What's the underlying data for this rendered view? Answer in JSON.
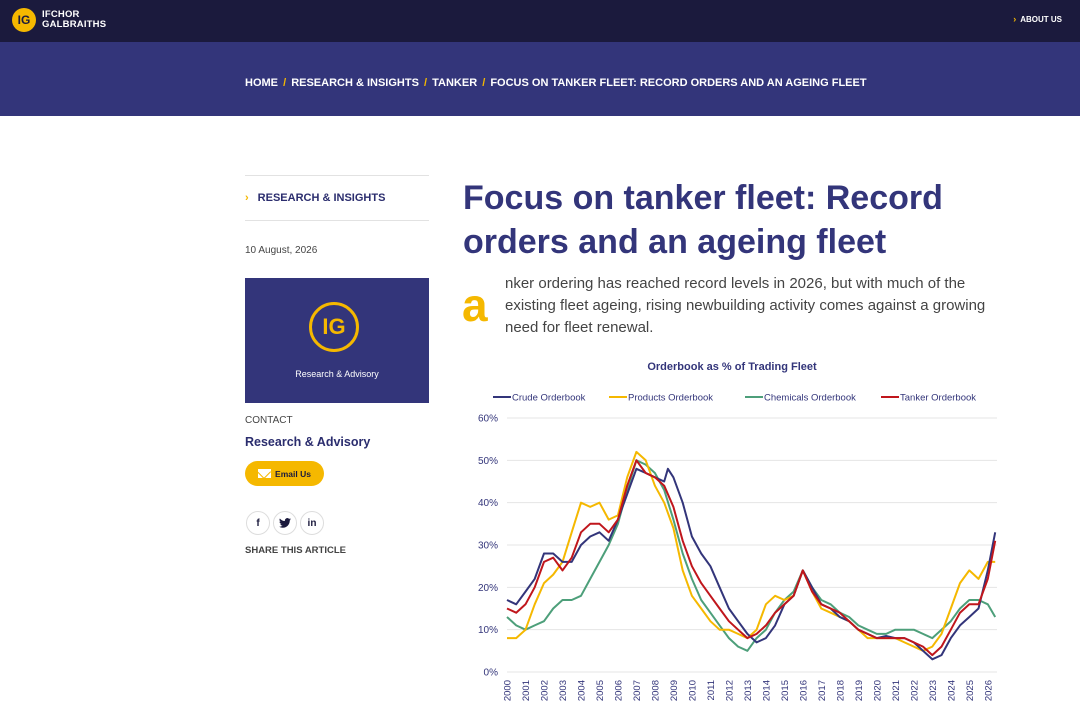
{
  "header": {
    "logo_mark": "IG",
    "logo_line1": "IFCHOR",
    "logo_line2": "GALBRAITHS",
    "about_label": "ABOUT US"
  },
  "breadcrumb": {
    "home": "HOME",
    "section": "RESEARCH & INSIGHTS",
    "category": "TANKER",
    "current": "FOCUS ON TANKER FLEET: RECORD ORDERS AND AN AGEING FLEET",
    "separator": "/"
  },
  "sidebar": {
    "section_link": "RESEARCH & INSIGHTS",
    "date": "10 August, 2026",
    "card_mark": "IG",
    "card_text": "Research & Advisory",
    "contact_label": "CONTACT",
    "contact_name": "Research & Advisory",
    "email_label": "Email Us",
    "share_label": "SHARE THIS ARTICLE",
    "social": [
      "f",
      "t",
      "in"
    ]
  },
  "article": {
    "title": "Focus on tanker fleet: Record orders and an ageing fleet",
    "dropcap": "a",
    "intro": "nker ordering has reached record levels in 2026, but with much of the existing fleet ageing, rising newbuilding activity comes against a growing need for fleet renewal."
  },
  "colors": {
    "navy": "#1b1a3d",
    "band": "#33357a",
    "accent": "#f5b800"
  },
  "chart_data": {
    "type": "line",
    "title": "Orderbook as % of Trading Fleet",
    "xlabel": "",
    "ylabel": "",
    "x_ticks": [
      "2000",
      "2001",
      "2002",
      "2003",
      "2004",
      "2005",
      "2006",
      "2007",
      "2008",
      "2009",
      "2010",
      "2011",
      "2012",
      "2013",
      "2014",
      "2015",
      "2016",
      "2017",
      "2018",
      "2019",
      "2020",
      "2021",
      "2022",
      "2023",
      "2024",
      "2025",
      "2026"
    ],
    "x_range": [
      2000,
      2026.5
    ],
    "ylim": [
      0,
      60
    ],
    "y_ticks": [
      "0%",
      "10%",
      "20%",
      "30%",
      "40%",
      "50%",
      "60%"
    ],
    "grid": "horizontal",
    "legend_position": "top",
    "series": [
      {
        "name": "Crude Orderbook",
        "color": "#33357a",
        "points": [
          [
            2000,
            17
          ],
          [
            2000.5,
            16
          ],
          [
            2001,
            19
          ],
          [
            2001.5,
            22
          ],
          [
            2002,
            28
          ],
          [
            2002.5,
            28
          ],
          [
            2003,
            26
          ],
          [
            2003.5,
            26
          ],
          [
            2004,
            30
          ],
          [
            2004.5,
            32
          ],
          [
            2005,
            33
          ],
          [
            2005.5,
            31
          ],
          [
            2006,
            36
          ],
          [
            2006.5,
            42
          ],
          [
            2007,
            48
          ],
          [
            2007.5,
            47
          ],
          [
            2008,
            46
          ],
          [
            2008.5,
            45
          ],
          [
            2008.7,
            48
          ],
          [
            2009,
            46
          ],
          [
            2009.5,
            40
          ],
          [
            2010,
            32
          ],
          [
            2010.5,
            28
          ],
          [
            2011,
            25
          ],
          [
            2011.5,
            20
          ],
          [
            2012,
            15
          ],
          [
            2012.5,
            12
          ],
          [
            2013,
            9
          ],
          [
            2013.5,
            7
          ],
          [
            2014,
            8
          ],
          [
            2014.5,
            11
          ],
          [
            2015,
            16
          ],
          [
            2015.5,
            18
          ],
          [
            2016,
            24
          ],
          [
            2016.5,
            20
          ],
          [
            2017,
            16
          ],
          [
            2017.5,
            15
          ],
          [
            2018,
            13
          ],
          [
            2018.5,
            12
          ],
          [
            2019,
            10
          ],
          [
            2019.5,
            9
          ],
          [
            2020,
            8
          ],
          [
            2020.5,
            8.5
          ],
          [
            2021,
            8
          ],
          [
            2021.5,
            8
          ],
          [
            2022,
            7
          ],
          [
            2022.5,
            5
          ],
          [
            2023,
            3
          ],
          [
            2023.5,
            4
          ],
          [
            2024,
            8
          ],
          [
            2024.5,
            11
          ],
          [
            2025,
            13
          ],
          [
            2025.5,
            15
          ],
          [
            2026,
            24
          ],
          [
            2026.4,
            33
          ]
        ]
      },
      {
        "name": "Products Orderbook",
        "color": "#f5b800",
        "points": [
          [
            2000,
            8
          ],
          [
            2000.5,
            8
          ],
          [
            2001,
            10
          ],
          [
            2001.5,
            16
          ],
          [
            2002,
            21
          ],
          [
            2002.5,
            23
          ],
          [
            2003,
            26
          ],
          [
            2003.5,
            33
          ],
          [
            2004,
            40
          ],
          [
            2004.5,
            39
          ],
          [
            2005,
            40
          ],
          [
            2005.5,
            36
          ],
          [
            2006,
            37
          ],
          [
            2006.5,
            46
          ],
          [
            2007,
            52
          ],
          [
            2007.5,
            50
          ],
          [
            2008,
            44
          ],
          [
            2008.5,
            40
          ],
          [
            2009,
            34
          ],
          [
            2009.5,
            24
          ],
          [
            2010,
            18
          ],
          [
            2010.5,
            15
          ],
          [
            2011,
            12
          ],
          [
            2011.5,
            10
          ],
          [
            2012,
            10
          ],
          [
            2012.5,
            9
          ],
          [
            2013,
            8
          ],
          [
            2013.5,
            10
          ],
          [
            2014,
            16
          ],
          [
            2014.5,
            18
          ],
          [
            2015,
            17
          ],
          [
            2015.5,
            18
          ],
          [
            2016,
            24
          ],
          [
            2016.5,
            19
          ],
          [
            2017,
            15
          ],
          [
            2017.5,
            14
          ],
          [
            2018,
            13
          ],
          [
            2018.5,
            12
          ],
          [
            2019,
            10
          ],
          [
            2019.5,
            8
          ],
          [
            2020,
            8
          ],
          [
            2020.5,
            8
          ],
          [
            2021,
            8
          ],
          [
            2021.5,
            7
          ],
          [
            2022,
            6
          ],
          [
            2022.5,
            5
          ],
          [
            2023,
            6
          ],
          [
            2023.5,
            9
          ],
          [
            2024,
            15
          ],
          [
            2024.5,
            21
          ],
          [
            2025,
            24
          ],
          [
            2025.5,
            22
          ],
          [
            2026,
            26
          ],
          [
            2026.4,
            26
          ]
        ]
      },
      {
        "name": "Chemicals Orderbook",
        "color": "#4d9f7a",
        "points": [
          [
            2000,
            13
          ],
          [
            2000.5,
            11
          ],
          [
            2001,
            10
          ],
          [
            2001.5,
            11
          ],
          [
            2002,
            12
          ],
          [
            2002.5,
            15
          ],
          [
            2003,
            17
          ],
          [
            2003.5,
            17
          ],
          [
            2004,
            18
          ],
          [
            2004.5,
            22
          ],
          [
            2005,
            26
          ],
          [
            2005.5,
            30
          ],
          [
            2006,
            35
          ],
          [
            2006.5,
            43
          ],
          [
            2007,
            50
          ],
          [
            2007.5,
            49
          ],
          [
            2008,
            47
          ],
          [
            2008.5,
            43
          ],
          [
            2009,
            36
          ],
          [
            2009.5,
            28
          ],
          [
            2010,
            22
          ],
          [
            2010.5,
            17
          ],
          [
            2011,
            14
          ],
          [
            2011.5,
            11
          ],
          [
            2012,
            8
          ],
          [
            2012.5,
            6
          ],
          [
            2013,
            5
          ],
          [
            2013.5,
            8
          ],
          [
            2014,
            10
          ],
          [
            2014.5,
            14
          ],
          [
            2015,
            17
          ],
          [
            2015.5,
            19
          ],
          [
            2016,
            24
          ],
          [
            2016.5,
            20
          ],
          [
            2017,
            17
          ],
          [
            2017.5,
            16
          ],
          [
            2018,
            14
          ],
          [
            2018.5,
            13
          ],
          [
            2019,
            11
          ],
          [
            2019.5,
            10
          ],
          [
            2020,
            9
          ],
          [
            2020.5,
            9
          ],
          [
            2021,
            10
          ],
          [
            2021.5,
            10
          ],
          [
            2022,
            10
          ],
          [
            2022.5,
            9
          ],
          [
            2023,
            8
          ],
          [
            2023.5,
            10
          ],
          [
            2024,
            12
          ],
          [
            2024.5,
            15
          ],
          [
            2025,
            17
          ],
          [
            2025.5,
            17
          ],
          [
            2026,
            16
          ],
          [
            2026.4,
            13
          ]
        ]
      },
      {
        "name": "Tanker Orderbook",
        "color": "#c0161c",
        "points": [
          [
            2000,
            15
          ],
          [
            2000.5,
            14
          ],
          [
            2001,
            16
          ],
          [
            2001.5,
            20
          ],
          [
            2002,
            26
          ],
          [
            2002.5,
            27
          ],
          [
            2003,
            24
          ],
          [
            2003.5,
            27
          ],
          [
            2004,
            33
          ],
          [
            2004.5,
            35
          ],
          [
            2005,
            35
          ],
          [
            2005.5,
            33
          ],
          [
            2006,
            36
          ],
          [
            2006.5,
            44
          ],
          [
            2007,
            50
          ],
          [
            2007.5,
            47
          ],
          [
            2008,
            46
          ],
          [
            2008.5,
            44
          ],
          [
            2009,
            39
          ],
          [
            2009.5,
            31
          ],
          [
            2010,
            25
          ],
          [
            2010.5,
            21
          ],
          [
            2011,
            18
          ],
          [
            2011.5,
            15
          ],
          [
            2012,
            12
          ],
          [
            2012.5,
            10
          ],
          [
            2013,
            8
          ],
          [
            2013.5,
            9
          ],
          [
            2014,
            11
          ],
          [
            2014.5,
            14
          ],
          [
            2015,
            16
          ],
          [
            2015.5,
            18
          ],
          [
            2016,
            24
          ],
          [
            2016.5,
            19
          ],
          [
            2017,
            16
          ],
          [
            2017.5,
            15
          ],
          [
            2018,
            14
          ],
          [
            2018.5,
            12
          ],
          [
            2019,
            10
          ],
          [
            2019.5,
            9
          ],
          [
            2020,
            8
          ],
          [
            2020.5,
            8
          ],
          [
            2021,
            8
          ],
          [
            2021.5,
            8
          ],
          [
            2022,
            7
          ],
          [
            2022.5,
            6
          ],
          [
            2023,
            4
          ],
          [
            2023.5,
            6
          ],
          [
            2024,
            10
          ],
          [
            2024.5,
            14
          ],
          [
            2025,
            16
          ],
          [
            2025.5,
            16
          ],
          [
            2026,
            22
          ],
          [
            2026.4,
            31
          ]
        ]
      }
    ]
  }
}
